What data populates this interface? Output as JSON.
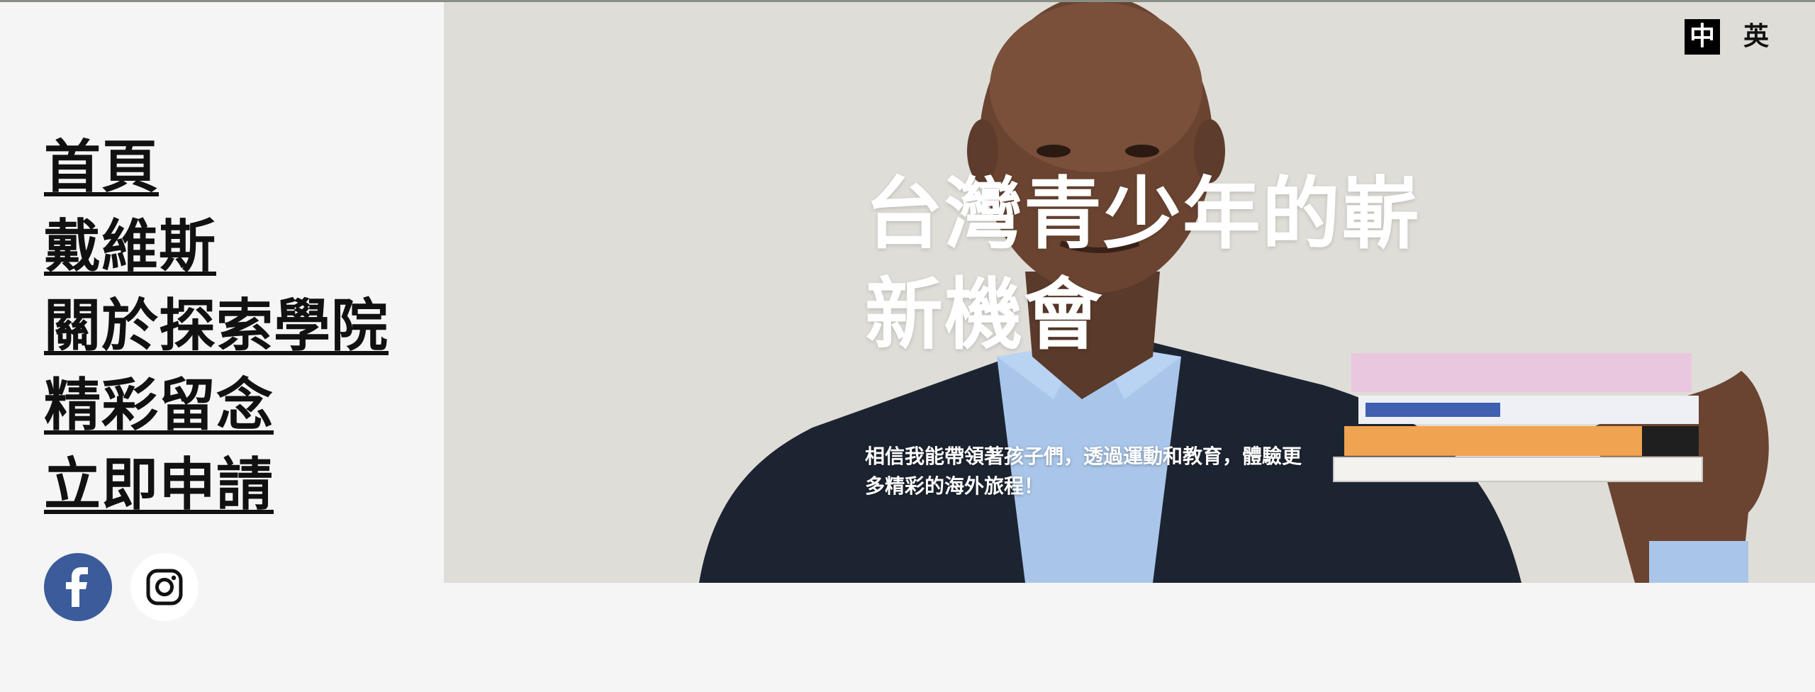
{
  "nav": {
    "items": [
      {
        "label": "首頁"
      },
      {
        "label": "戴維斯"
      },
      {
        "label": "關於探索學院"
      },
      {
        "label": "精彩留念"
      },
      {
        "label": "立即申請"
      }
    ]
  },
  "social": {
    "facebook_icon": "facebook-icon",
    "instagram_icon": "instagram-icon",
    "colors": {
      "facebook": "#3b5b9b",
      "instagram_bg": "#ffffff"
    }
  },
  "language": {
    "options": [
      "中",
      "英"
    ],
    "selected": "中"
  },
  "hero": {
    "headline": "台灣青少年的嶄新機會",
    "subtext": "相信我能帶領著孩子們，透過運動和教育，體驗更多精彩的海外旅程！"
  }
}
